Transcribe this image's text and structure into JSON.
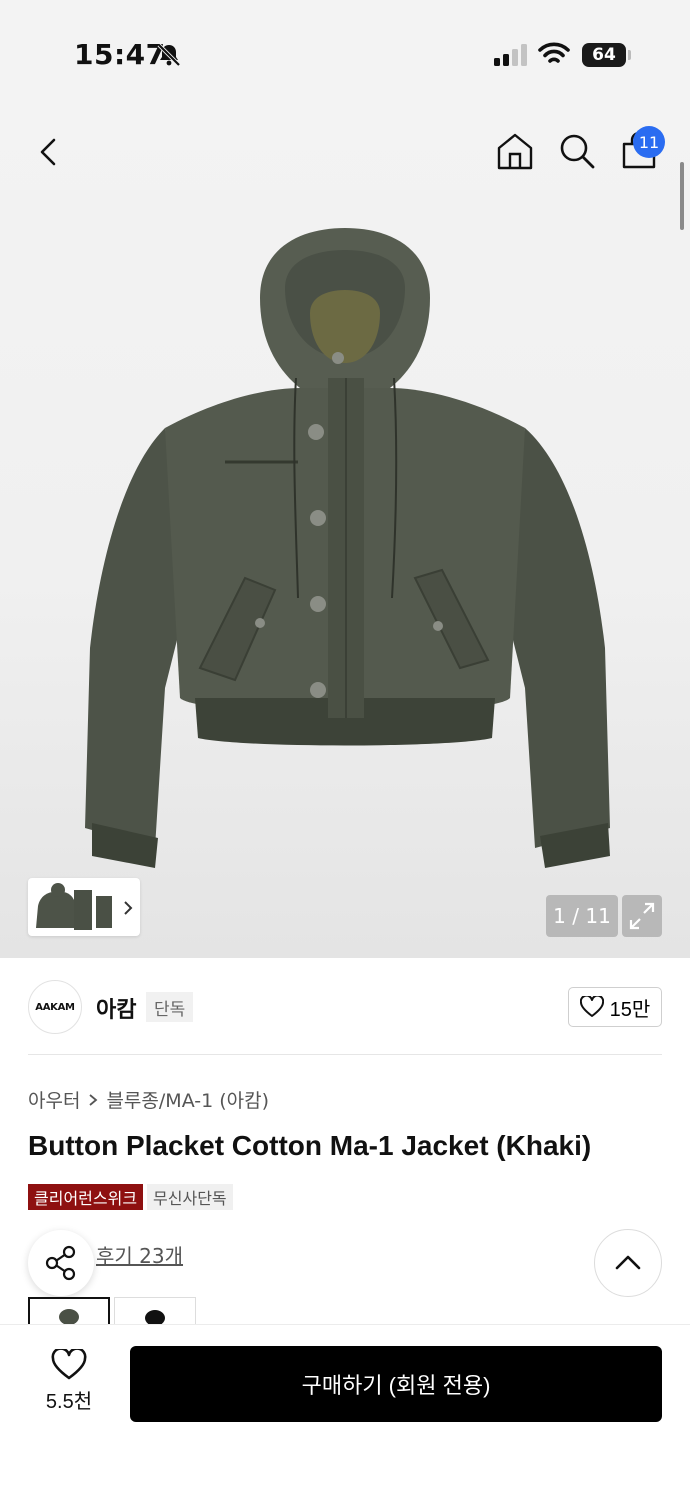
{
  "status_bar": {
    "time": "15:47",
    "battery": "64"
  },
  "header": {
    "cart_count": "11"
  },
  "gallery": {
    "counter": "1 / 11"
  },
  "brand": {
    "logo_text": "AAKAM",
    "name": "아캄",
    "tag": "단독",
    "likes": "15만"
  },
  "breadcrumb": {
    "level1": "아우터",
    "level2": "블루종/MA-1 (아캄)"
  },
  "product": {
    "title": "Button Placket Cotton Ma-1 Jacket (Khaki)",
    "tags": [
      "클리어런스위크",
      "무신사단독"
    ],
    "review_link": "후기 23개"
  },
  "bottom_bar": {
    "wishlist_count": "5.5천",
    "buy_label": "구매하기 (회원 전용)"
  },
  "colors": {
    "accent_blue": "#2a6cf1",
    "tag_red": "#8e1010",
    "jacket": "#4a5045"
  }
}
